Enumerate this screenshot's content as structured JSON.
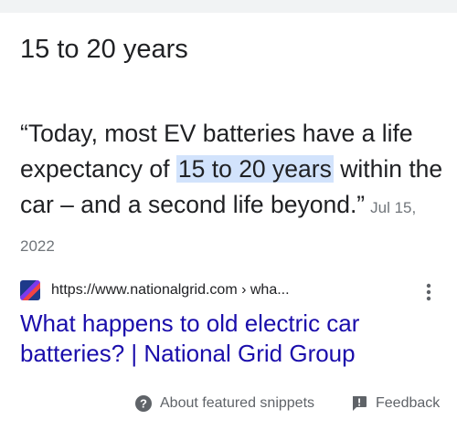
{
  "featured": {
    "answer": "15 to 20 years",
    "quote_before": "“Today, most EV batteries have a life expectancy of ",
    "quote_highlight": "15 to 20 years",
    "quote_after": " within the car – and a second life beyond.”",
    "date": "Jul 15, 2022"
  },
  "source": {
    "url": "https://www.nationalgrid.com › wha...",
    "title": "What happens to old electric car batteries? | National Grid Group",
    "favicon_colors": [
      "#1e3a8a",
      "#7c3aed",
      "#ef4444"
    ]
  },
  "footer": {
    "about_label": "About featured snippets",
    "feedback_label": "Feedback"
  },
  "colors": {
    "highlight": "#d2e3fc",
    "link": "#1a0dab",
    "muted": "#5f6368"
  },
  "icons": [
    "help-circle-icon",
    "feedback-icon",
    "more-vert-icon",
    "site-favicon-icon"
  ]
}
